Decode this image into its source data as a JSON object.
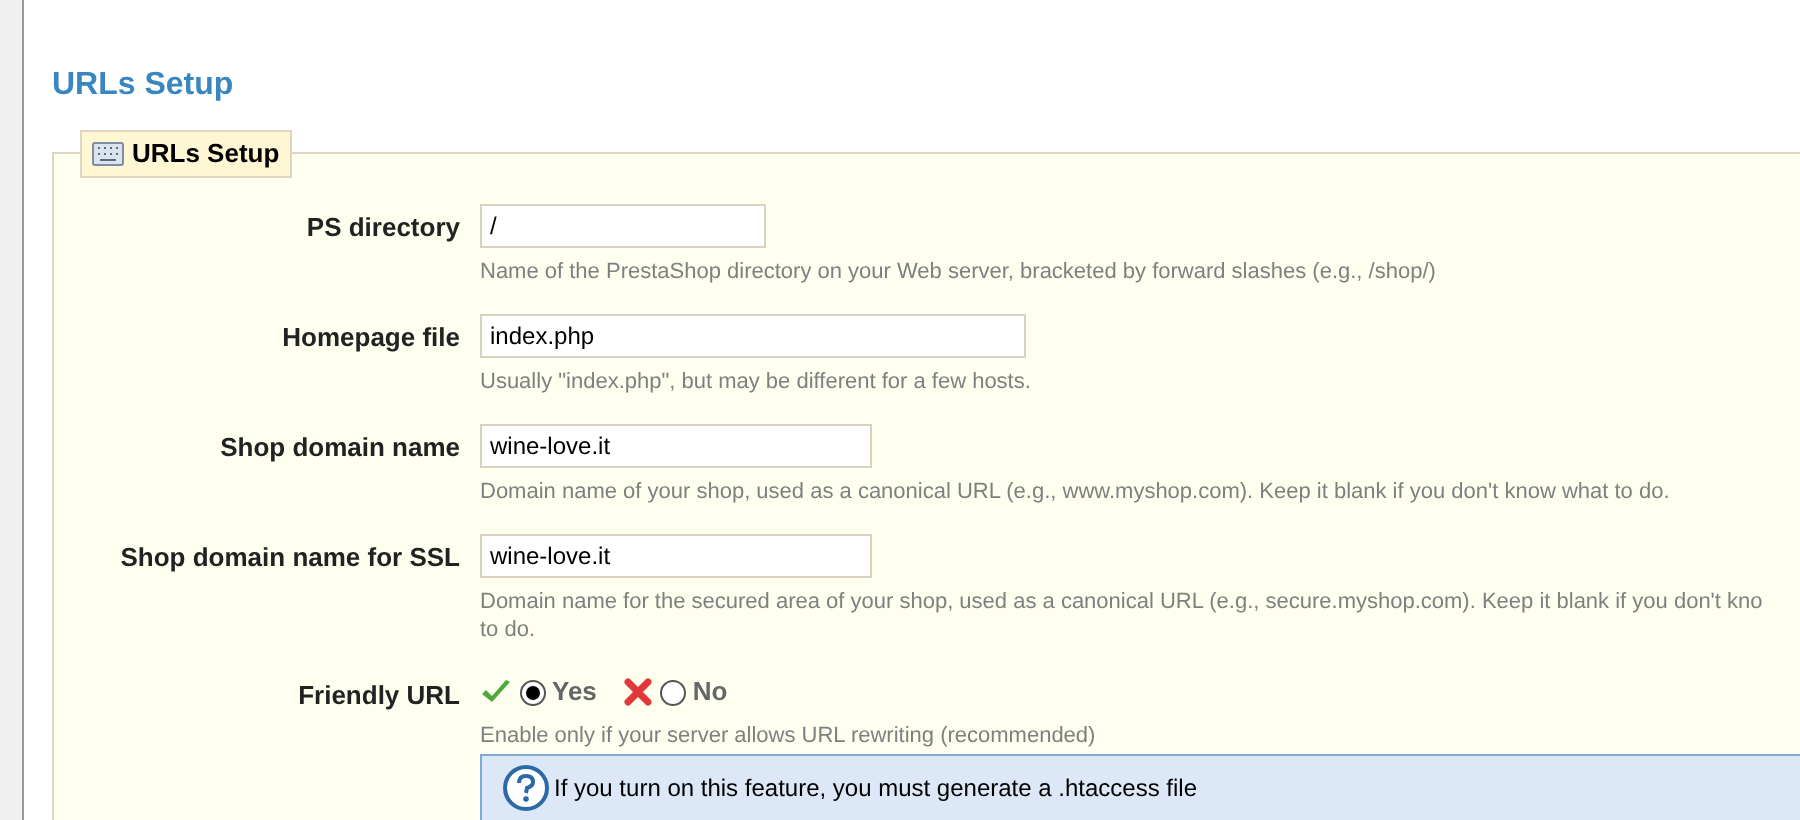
{
  "page_title": "URLs Setup",
  "fieldset": {
    "legend": "URLs Setup",
    "fields": [
      {
        "kind": "text",
        "label": "PS directory",
        "value": "/",
        "hint_lines": [
          "Name of the PrestaShop directory on your Web server, bracketed by forward slashes (e.g., /shop/)"
        ]
      },
      {
        "kind": "text",
        "label": "Homepage file",
        "value": "index.php",
        "hint_lines": [
          "Usually \"index.php\", but may be different for a few hosts."
        ]
      },
      {
        "kind": "text",
        "label": "Shop domain name",
        "value": "wine-love.it",
        "hint_lines": [
          "Domain name of your shop, used as a canonical URL (e.g., www.myshop.com). Keep it blank if you don't know what to do."
        ]
      },
      {
        "kind": "text",
        "label": "Shop domain name for SSL",
        "value": "wine-love.it",
        "hint_lines": [
          "Domain name for the secured area of your shop, used as a canonical URL (e.g., secure.myshop.com). Keep it blank if you don't kno",
          "to do."
        ]
      },
      {
        "kind": "radio",
        "label": "Friendly URL",
        "options": [
          {
            "label": "Yes",
            "selected": true
          },
          {
            "label": "No",
            "selected": false
          }
        ],
        "hint_lines": [
          "Enable only if your server allows URL rewriting (recommended)"
        ],
        "notice": "If you turn on this feature, you must generate a .htaccess file"
      }
    ]
  }
}
